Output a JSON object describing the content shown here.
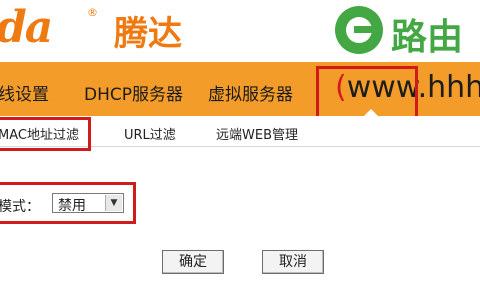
{
  "brand": {
    "en": "da",
    "reg": "®",
    "cn": "腾达"
  },
  "watermark": {
    "text": "路由",
    "color": "#43a843"
  },
  "nav": {
    "items": [
      "线设置",
      "DHCP服务器",
      "虚拟服务器"
    ],
    "url_text": "www.hhh",
    "paren": "("
  },
  "subnav": {
    "items": [
      "MAC地址过滤",
      "URL过滤",
      "远端WEB管理"
    ]
  },
  "form": {
    "mode_label": "模式：",
    "mode_value": "禁用"
  },
  "buttons": {
    "ok": "确定",
    "cancel": "取消"
  },
  "colors": {
    "brand_orange": "#f07a12",
    "nav_bg": "#f49c2a",
    "highlight": "#d11a1a"
  }
}
